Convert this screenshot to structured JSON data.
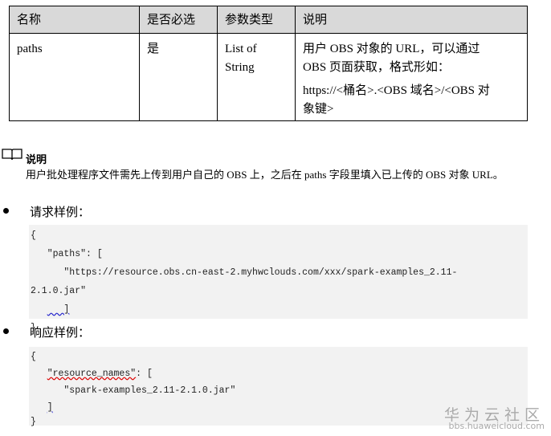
{
  "table": {
    "headers": [
      "名称",
      "是否必选",
      "参数类型",
      "说明"
    ],
    "row": {
      "name": "paths",
      "required": "是",
      "type_line1": "List of",
      "type_line2": "String",
      "desc_line1": "用户 OBS 对象的 URL，可以通过",
      "desc_line2": "OBS 页面获取，格式形如：",
      "desc_line3": "https://<桶名>.<OBS 域名>/<OBS 对",
      "desc_line4": "象键>"
    }
  },
  "note": {
    "title": "说明",
    "text": "用户批处理程序文件需先上传到用户自己的 OBS 上，之后在 paths 字段里填入已上传的 OBS 对象 URL。"
  },
  "request": {
    "label": "请求样例：",
    "lines": [
      "{ ",
      "   \"paths\": [ ",
      "      \"https://resource.obs.cn-east-2.myhwclouds.com/xxx/spark-examples_2.11-",
      "2.1.0.jar\" ",
      "   ]",
      "}"
    ]
  },
  "response": {
    "label": "响应样例：",
    "l0": "{ ",
    "key": "\"resource_names\"",
    "l1rest": ": [ ",
    "l2": "      \"spark-examples_2.11-2.1.0.jar\" ",
    "l3": "]",
    "l4": "}"
  },
  "watermark": {
    "title": "华为云社区",
    "url": "bbs.huaweicloud.com"
  }
}
